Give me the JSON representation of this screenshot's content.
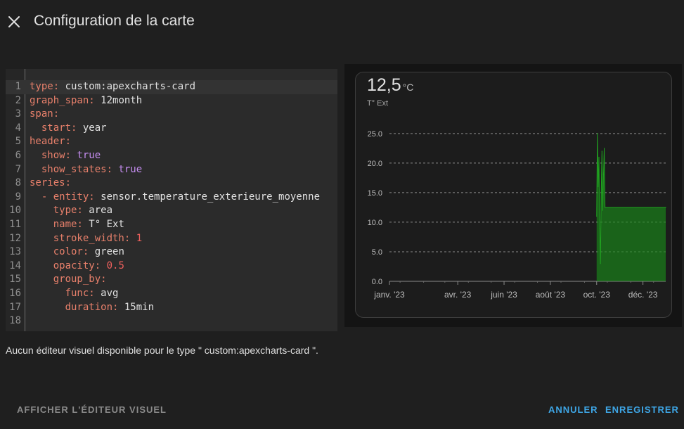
{
  "dialog": {
    "title": "Configuration de la carte",
    "close_icon": "close-icon"
  },
  "editor": {
    "lines": [
      {
        "num": "1",
        "indent": "",
        "key": "type",
        "sep": ": ",
        "value": "custom:apexcharts-card",
        "vtype": "str"
      },
      {
        "num": "2",
        "indent": "",
        "key": "graph_span",
        "sep": ": ",
        "value": "12month",
        "vtype": "str"
      },
      {
        "num": "3",
        "indent": "",
        "key": "span",
        "sep": ":",
        "value": "",
        "vtype": "str"
      },
      {
        "num": "4",
        "indent": "  ",
        "key": "start",
        "sep": ": ",
        "value": "year",
        "vtype": "str"
      },
      {
        "num": "5",
        "indent": "",
        "key": "header",
        "sep": ":",
        "value": "",
        "vtype": "str"
      },
      {
        "num": "6",
        "indent": "  ",
        "key": "show",
        "sep": ": ",
        "value": "true",
        "vtype": "bool"
      },
      {
        "num": "7",
        "indent": "  ",
        "key": "show_states",
        "sep": ": ",
        "value": "true",
        "vtype": "bool"
      },
      {
        "num": "8",
        "indent": "",
        "key": "series",
        "sep": ":",
        "value": "",
        "vtype": "str"
      },
      {
        "num": "9",
        "indent": "  - ",
        "key": "entity",
        "sep": ": ",
        "value": "sensor.temperature_exterieure_moyenne",
        "vtype": "str"
      },
      {
        "num": "10",
        "indent": "    ",
        "key": "type",
        "sep": ": ",
        "value": "area",
        "vtype": "str"
      },
      {
        "num": "11",
        "indent": "    ",
        "key": "name",
        "sep": ": ",
        "value": "T° Ext",
        "vtype": "str"
      },
      {
        "num": "12",
        "indent": "    ",
        "key": "stroke_width",
        "sep": ": ",
        "value": "1",
        "vtype": "num"
      },
      {
        "num": "13",
        "indent": "    ",
        "key": "color",
        "sep": ": ",
        "value": "green",
        "vtype": "str"
      },
      {
        "num": "14",
        "indent": "    ",
        "key": "opacity",
        "sep": ": ",
        "value": "0.5",
        "vtype": "num"
      },
      {
        "num": "15",
        "indent": "    ",
        "key": "group_by",
        "sep": ":",
        "value": "",
        "vtype": "str"
      },
      {
        "num": "16",
        "indent": "      ",
        "key": "func",
        "sep": ": ",
        "value": "avg",
        "vtype": "str"
      },
      {
        "num": "17",
        "indent": "      ",
        "key": "duration",
        "sep": ": ",
        "value": "15min",
        "vtype": "str"
      },
      {
        "num": "18",
        "indent": "",
        "key": "",
        "sep": "",
        "value": "",
        "vtype": "str"
      }
    ]
  },
  "hint": "Aucun éditeur visuel disponible pour le type \" custom:apexcharts-card \".",
  "card": {
    "state_value": "12,5",
    "state_unit": "°C",
    "state_name": "T° Ext"
  },
  "chart_data": {
    "type": "area",
    "title": "",
    "x_tick_labels": [
      "janv. '23",
      "avr. '23",
      "juin '23",
      "août '23",
      "oct. '23",
      "déc. '23"
    ],
    "y_tick_labels": [
      "0.0",
      "5.0",
      "10.0",
      "15.0",
      "20.0",
      "25.0"
    ],
    "ylim": [
      0,
      27
    ],
    "grid": true,
    "series": [
      {
        "name": "T° Ext",
        "color": "#1a8a1a",
        "opacity": 0.5,
        "points": [
          {
            "x": "2023-10-01",
            "y": 11
          },
          {
            "x": "2023-10-02",
            "y": 25
          },
          {
            "x": "2023-10-03",
            "y": 16
          },
          {
            "x": "2023-10-04",
            "y": 21
          },
          {
            "x": "2023-10-05",
            "y": 9
          },
          {
            "x": "2023-10-06",
            "y": 3
          },
          {
            "x": "2023-10-07",
            "y": 15
          },
          {
            "x": "2023-10-08",
            "y": 22
          },
          {
            "x": "2023-10-09",
            "y": 12
          },
          {
            "x": "2023-10-10",
            "y": 18
          },
          {
            "x": "2023-10-11",
            "y": 22.5
          },
          {
            "x": "2023-10-12",
            "y": 12.5
          },
          {
            "x": "2023-12-31",
            "y": 12.5
          }
        ]
      }
    ]
  },
  "footer": {
    "visual_editor_label": "AFFICHER L'ÉDITEUR VISUEL",
    "cancel_label": "ANNULER",
    "save_label": "ENREGISTRER"
  },
  "colors": {
    "accent": "#3ea6e6",
    "background": "#1f1f1f",
    "yaml_key": "#e8806b",
    "yaml_bool": "#c58df0",
    "yaml_number": "#f0605d"
  }
}
